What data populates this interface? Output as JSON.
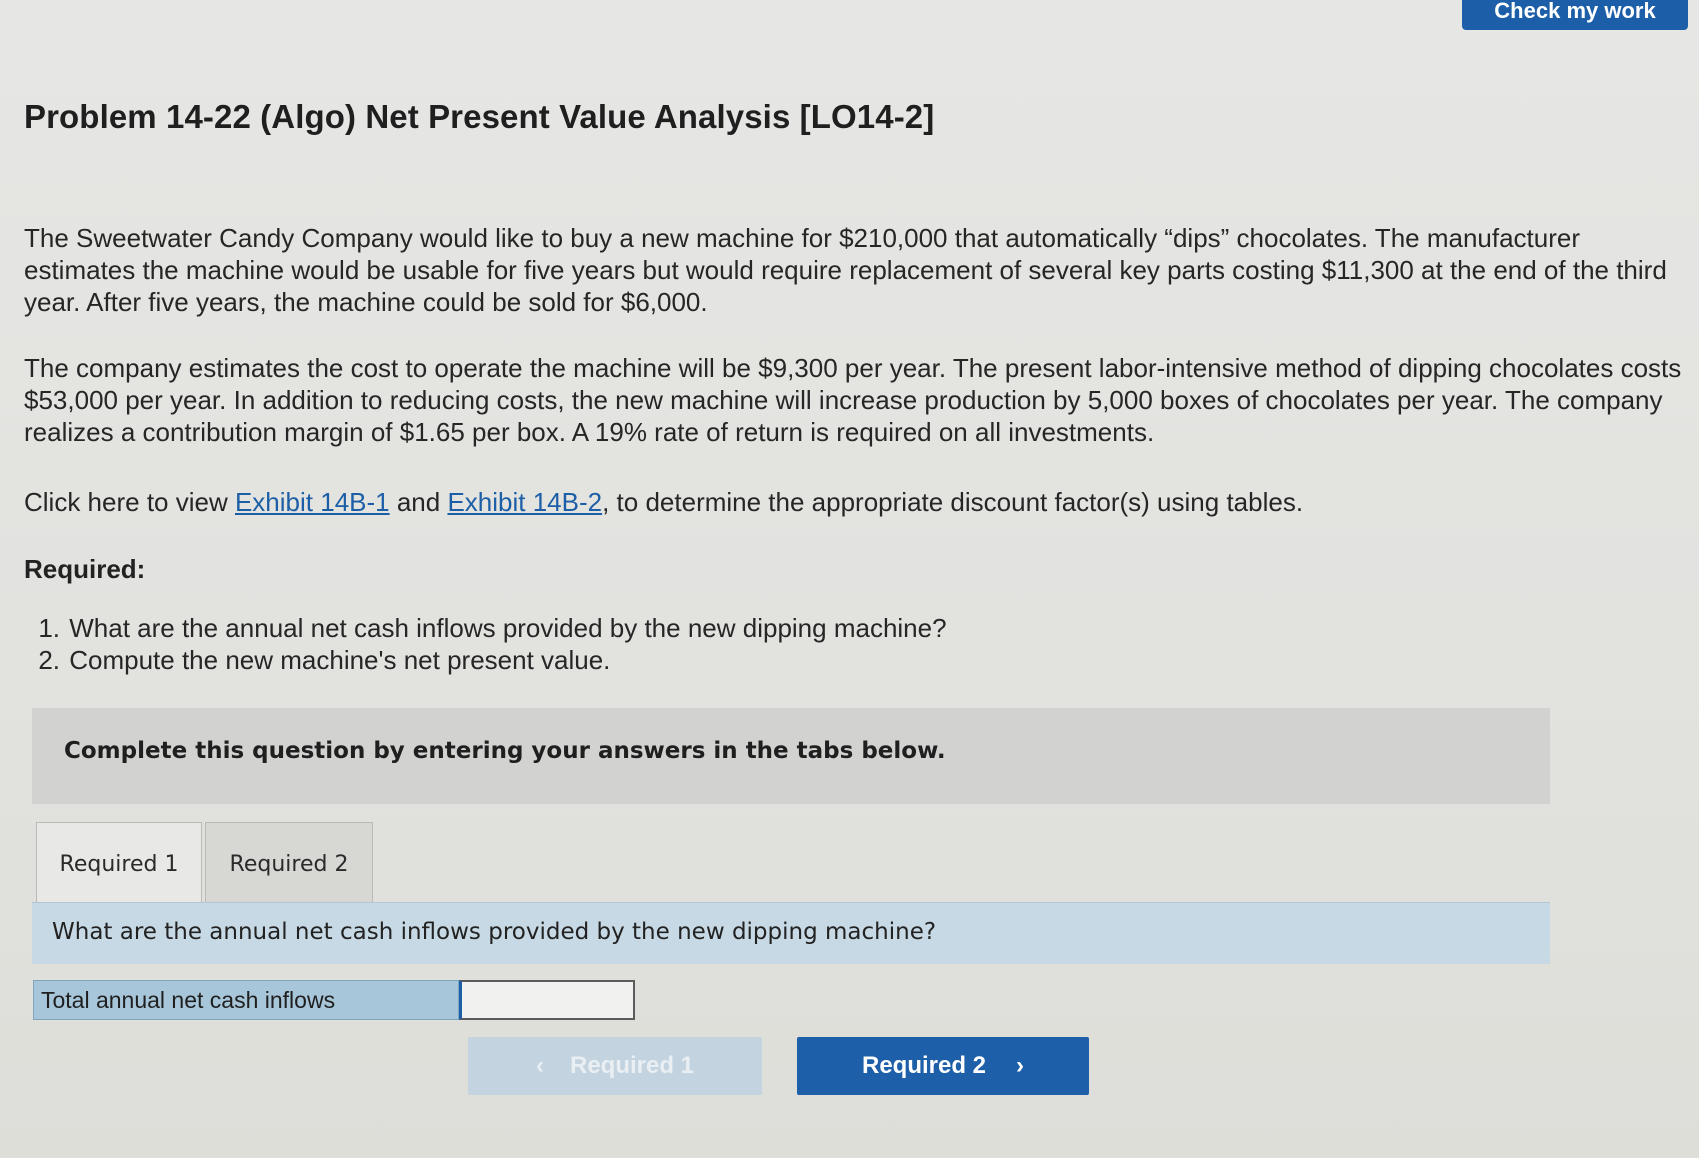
{
  "header": {
    "check_button": "Check my work"
  },
  "problem": {
    "title": "Problem 14-22 (Algo) Net Present Value Analysis [LO14-2]",
    "paragraph1": "The Sweetwater Candy Company would like to buy a new machine for $210,000 that automatically “dips” chocolates. The manufacturer estimates the machine would be usable for five years but would require replacement of several key parts costing $11,300 at the end of the third year. After five years, the machine could be sold for $6,000.",
    "paragraph2": "The company estimates the cost to operate the machine will be $9,300 per year. The present labor-intensive method of dipping chocolates costs $53,000 per year. In addition to reducing costs, the new machine will increase production by 5,000 boxes of chocolates per year. The company realizes a contribution margin of $1.65 per box. A 19% rate of return is required on all investments.",
    "exhibit_line": {
      "prefix": "Click here to view ",
      "link1": "Exhibit 14B-1",
      "between": " and ",
      "link2": "Exhibit 14B-2",
      "suffix": ", to determine the appropriate discount factor(s) using tables."
    },
    "required_heading": "Required:",
    "requirements": [
      {
        "num": "1.",
        "text": "What are the annual net cash inflows provided by the new dipping machine?"
      },
      {
        "num": "2.",
        "text": "Compute the new machine's net present value."
      }
    ]
  },
  "instructions": "Complete this question by entering your answers in the tabs below.",
  "tabs": [
    {
      "label": "Required 1",
      "active": true
    },
    {
      "label": "Required 2",
      "active": false
    }
  ],
  "question": "What are the annual net cash inflows provided by the new dipping machine?",
  "answer": {
    "label": "Total annual net cash inflows",
    "value": ""
  },
  "navigation": {
    "prev_label": "Required 1",
    "next_label": "Required 2",
    "prev_icon": "chevron-left-icon",
    "next_icon": "chevron-right-icon"
  },
  "colors": {
    "primary": "#1d5fa8",
    "link": "#1d5fa6",
    "question_bar": "#c6d9e4",
    "answer_label_bg": "#a7c6d9",
    "disabled_button": "#c3d3df"
  }
}
